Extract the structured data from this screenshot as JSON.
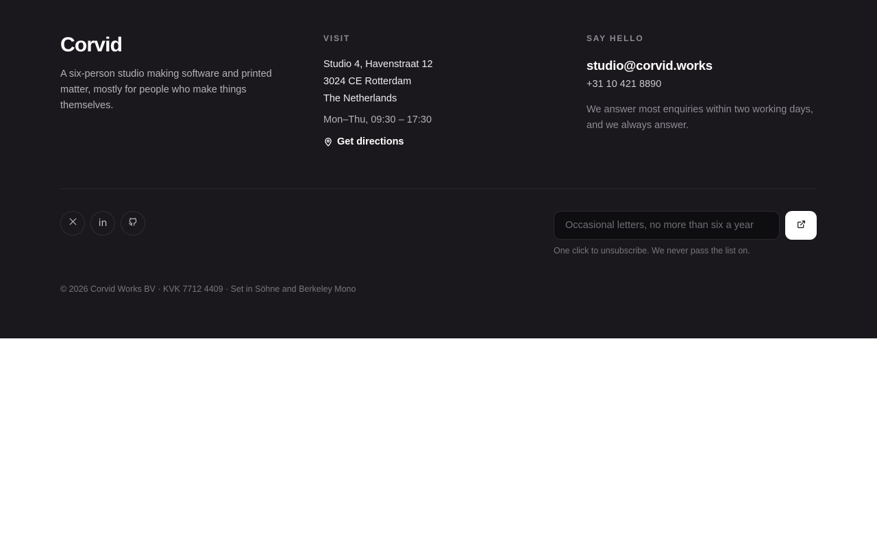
{
  "brand": {
    "name": "Corvid",
    "tagline": "A six-person studio making software and printed matter, mostly for people who make things themselves."
  },
  "visit": {
    "heading": "VISIT",
    "address_lines": [
      "Studio 4, Havenstraat 12",
      "3024 CE Rotterdam",
      "The Netherlands"
    ],
    "hours": "Mon–Thu, 09:30 – 17:30",
    "directions_label": "Get directions",
    "directions_icon": "map-pin-icon"
  },
  "contact": {
    "heading": "SAY HELLO",
    "email": "studio@corvid.works",
    "phone": "+31 10 421 8890",
    "note": "We answer most enquiries within two working days, and we always answer."
  },
  "socials": [
    {
      "name": "x",
      "icon": "x-icon"
    },
    {
      "name": "linkedin",
      "icon": "linkedin-icon",
      "glyph": "in"
    },
    {
      "name": "github",
      "icon": "github-icon"
    }
  ],
  "newsletter": {
    "placeholder": "Occasional letters, no more than six a year",
    "value": "",
    "submit_icon": "external-link-icon",
    "note": "One click to unsubscribe. We never pass the list on."
  },
  "legal": {
    "text": "© 2026 Corvid Works BV · KVK 7712 4409 · Set in Söhne and Berkeley Mono"
  },
  "colors": {
    "footer_bg": "#1a181c",
    "page_bg": "#ffffff",
    "accent": "#ffffff",
    "muted_text": "#8e8c93"
  }
}
